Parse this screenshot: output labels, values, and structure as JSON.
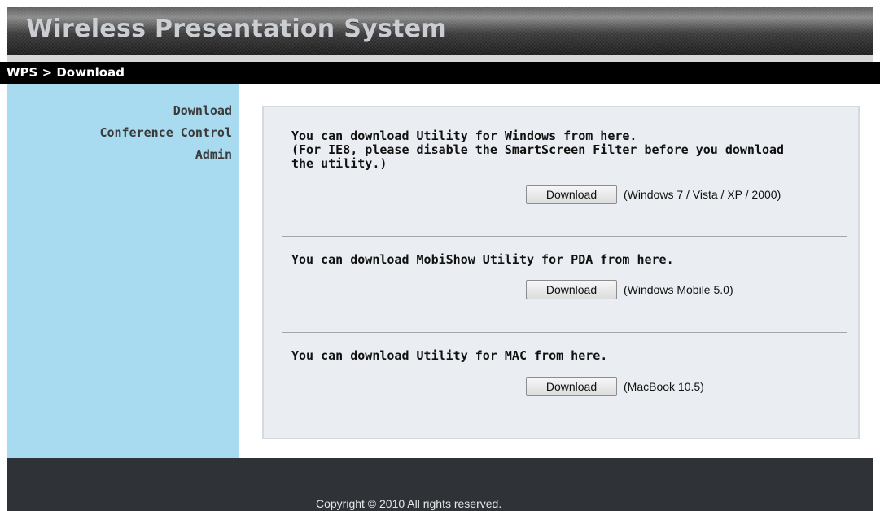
{
  "app": {
    "title": "Wireless Presentation System"
  },
  "breadcrumb": "WPS > Download",
  "sidebar": {
    "items": [
      {
        "label": "Download"
      },
      {
        "label": "Conference Control"
      },
      {
        "label": "Admin"
      }
    ]
  },
  "main": {
    "sections": [
      {
        "lines": [
          "You can download Utility for Windows from here.",
          "(For IE8, please disable the SmartScreen Filter before you download",
          "the utility.)"
        ],
        "button_label": "Download",
        "note": "(Windows 7 / Vista / XP / 2000)"
      },
      {
        "lines": [
          "You can download MobiShow Utility for PDA from here."
        ],
        "button_label": "Download",
        "note": "(Windows Mobile 5.0)"
      },
      {
        "lines": [
          "You can download Utility for MAC from here."
        ],
        "button_label": "Download",
        "note": "(MacBook 10.5)"
      }
    ]
  },
  "footer": {
    "copyright": "Copyright © 2010 All rights reserved."
  },
  "colors": {
    "sidebar_bg": "#a8daf0",
    "panel_bg": "#eaedf2",
    "footer_bg": "#2f3338",
    "breadcrumb_bg": "#000000"
  }
}
